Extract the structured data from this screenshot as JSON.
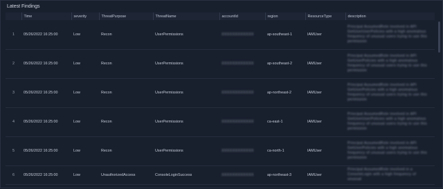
{
  "panel": {
    "title": "Latest Findings"
  },
  "table": {
    "columns": [
      "",
      "Time",
      "severity",
      "ThreatPurpose",
      "ThreatName",
      "accountId",
      "region",
      "ResourceType",
      "description"
    ],
    "rows": [
      {
        "idx": "1",
        "time": "05/26/2022 16:25:00",
        "severity": "Low",
        "purpose": "Recon",
        "name": "UserPermissions",
        "account": "XXXXXXXXXXXX",
        "region": "ap-southeast-1",
        "type": "IAMUser",
        "description": "Principal AssumedRole involved in API GetUserUserPolicies with a high anomalous frequency of unusual users trying to use this permission"
      },
      {
        "idx": "2",
        "time": "05/26/2022 16:25:00",
        "severity": "Low",
        "purpose": "Recon",
        "name": "UserPermissions",
        "account": "XXXXXXXXXXXX",
        "region": "ap-southeast-2",
        "type": "IAMUser",
        "description": "Principal AssumedRole involved in API GetUserPolicies with a high anomalous frequency of unusual users trying to use this permission"
      },
      {
        "idx": "3",
        "time": "05/26/2022 16:25:00",
        "severity": "Low",
        "purpose": "Recon",
        "name": "UserPermissions",
        "account": "XXXXXXXXXXXX",
        "region": "ap-northeast-2",
        "type": "IAMUser",
        "description": "Principal AssumedRole involved in API GetUserPolicies with a high anomalous frequency of unusual users trying to use this permission"
      },
      {
        "idx": "4",
        "time": "05/26/2022 16:25:00",
        "severity": "Low",
        "purpose": "Recon",
        "name": "UserPermissions",
        "account": "XXXXXXXXXXXX",
        "region": "ca-east-1",
        "type": "IAMUser",
        "description": "Principal AssumedRole involved in API GetUserUserPolicies with a high anomalous frequency of unusual users trying to use this permission"
      },
      {
        "idx": "5",
        "time": "05/26/2022 16:25:00",
        "severity": "Low",
        "purpose": "Recon",
        "name": "UserPermissions",
        "account": "XXXXXXXXXXXX",
        "region": "ca-north-1",
        "type": "IAMUser",
        "description": "Principal AssumedRole involved in API GetUserPolicies with a high anomalous frequency of unusual users trying to use this permission"
      },
      {
        "idx": "6",
        "time": "05/26/2022 16:25:00",
        "severity": "Low",
        "purpose": "UnauthorizedAccess",
        "name": "ConsoleLoginSuccess",
        "account": "XXXXXXXXXXXX",
        "region": "ap-northeast-3",
        "type": "IAMUser",
        "description": "Principal AssumedRole involved in a ConsoleLogin with a high frequency of unusual"
      }
    ]
  }
}
